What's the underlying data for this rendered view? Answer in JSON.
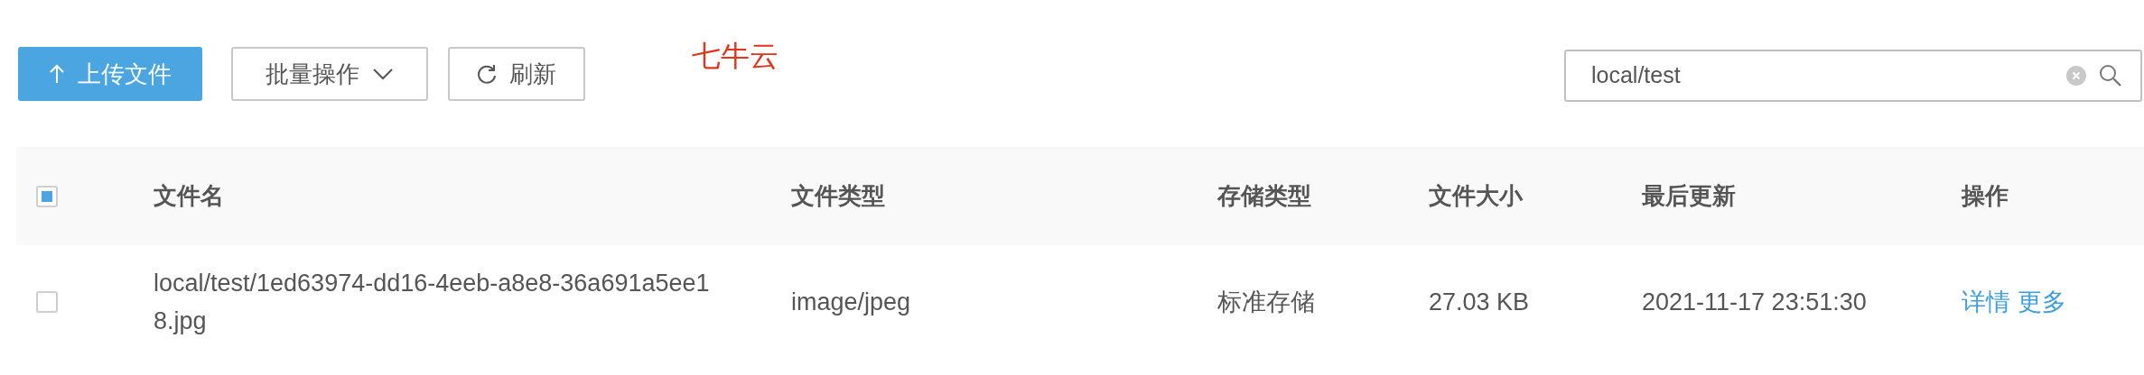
{
  "toolbar": {
    "buttons": [
      {
        "label": "上传文件",
        "kind": "upload"
      },
      {
        "label": "批量操作",
        "kind": "dropdown"
      },
      {
        "label": "刷新",
        "kind": "refresh"
      }
    ],
    "brand": "七牛云",
    "search": {
      "value": "local/test"
    }
  },
  "table": {
    "select_all": {
      "checked": false,
      "indeterminate": true
    },
    "columns": [
      "文件名",
      "文件类型",
      "存储类型",
      "文件大小",
      "最后更新",
      "操作"
    ],
    "rows": [
      {
        "checked": false,
        "cells": [
          "local/test/1ed63974-dd16-4eeb-a8e8-36a691a5ee18.jpg",
          "image/jpeg",
          "标准存储",
          "27.03 KB",
          "2021-11-17 23:51:30"
        ],
        "actions": [
          "详情",
          "更多"
        ]
      }
    ]
  }
}
